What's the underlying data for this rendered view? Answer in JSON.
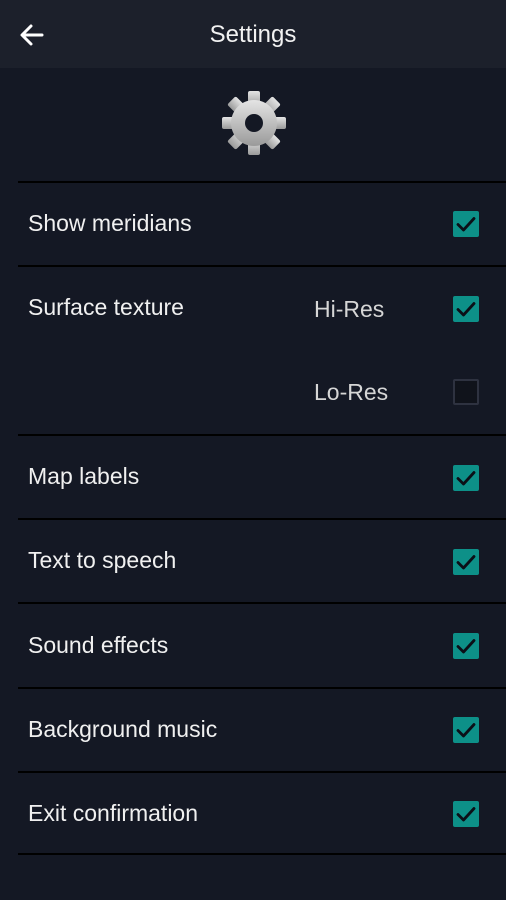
{
  "header": {
    "title": "Settings",
    "back_icon": "arrow-left-icon"
  },
  "header_icon": "gear-icon",
  "settings": {
    "show_meridians": {
      "label": "Show meridians",
      "checked": true
    },
    "surface_texture": {
      "label": "Surface texture",
      "options": [
        {
          "label": "Hi-Res",
          "checked": true
        },
        {
          "label": "Lo-Res",
          "checked": false
        }
      ]
    },
    "map_labels": {
      "label": "Map labels",
      "checked": true
    },
    "text_to_speech": {
      "label": "Text to speech",
      "checked": true
    },
    "sound_effects": {
      "label": "Sound effects",
      "checked": true
    },
    "background_music": {
      "label": "Background music",
      "checked": true
    },
    "exit_confirmation": {
      "label": "Exit confirmation",
      "checked": true
    }
  },
  "colors": {
    "background": "#141824",
    "topbar": "#1c202b",
    "checkbox_checked": "#0d9088",
    "divider": "#000000"
  }
}
